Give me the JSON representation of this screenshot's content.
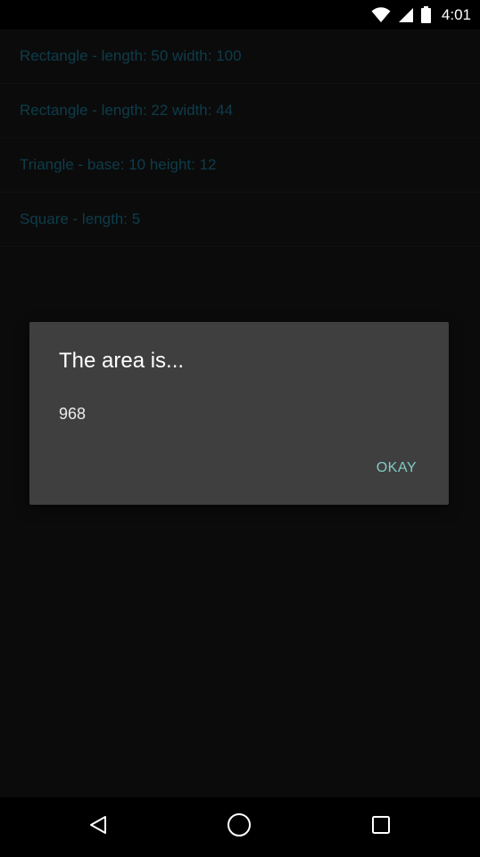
{
  "status_bar": {
    "time": "4:01",
    "icons": [
      "wifi-icon",
      "cell-signal-icon",
      "battery-icon"
    ]
  },
  "list": {
    "items": [
      {
        "label": "Rectangle - length: 50 width: 100"
      },
      {
        "label": "Rectangle - length: 22 width: 44"
      },
      {
        "label": "Triangle - base: 10 height: 12"
      },
      {
        "label": "Square - length: 5"
      }
    ]
  },
  "dialog": {
    "title": "The area is...",
    "message": "968",
    "button_label": "OKAY"
  },
  "nav_bar": {
    "icons": [
      "back-icon",
      "home-icon",
      "recents-icon"
    ]
  },
  "colors": {
    "list_text": "#1a6d87",
    "dialog_bg": "#3f3f3f",
    "button_text": "#80cbc4",
    "background": "#141414"
  }
}
